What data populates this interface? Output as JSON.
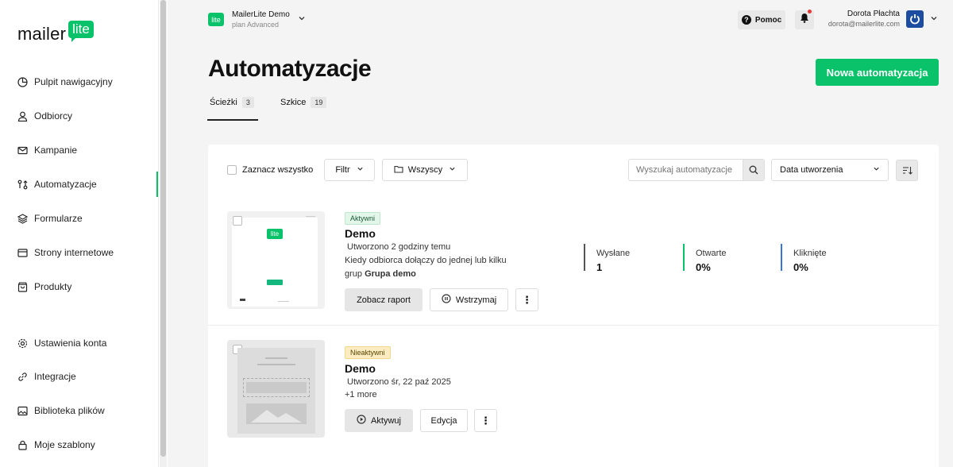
{
  "sidebar": {
    "logo_text": "mailer",
    "logo_badge": "lite",
    "items": [
      {
        "label": "Pulpit nawigacyjny",
        "icon": "dashboard-icon"
      },
      {
        "label": "Odbiorcy",
        "icon": "person-icon"
      },
      {
        "label": "Kampanie",
        "icon": "mail-icon"
      },
      {
        "label": "Automatyzacje",
        "icon": "automation-icon"
      },
      {
        "label": "Formularze",
        "icon": "layers-icon"
      },
      {
        "label": "Strony internetowe",
        "icon": "browser-icon"
      },
      {
        "label": "Produkty",
        "icon": "bag-icon"
      },
      {
        "label": "Ustawienia konta",
        "icon": "gear-icon"
      },
      {
        "label": "Integracje",
        "icon": "link-icon"
      },
      {
        "label": "Biblioteka plików",
        "icon": "image-icon"
      },
      {
        "label": "Moje szablony",
        "icon": "lock-icon"
      }
    ]
  },
  "header": {
    "account_logo": "lite",
    "account_name": "MailerLite Demo",
    "account_plan": "plan Advanced",
    "help_label": "Pomoc",
    "user_name": "Dorota Płachta",
    "user_email": "dorota@mailerlite.com"
  },
  "page": {
    "title": "Automatyzacje",
    "new_button": "Nowa automatyzacja",
    "tabs": [
      {
        "label": "Ścieżki",
        "count": "3"
      },
      {
        "label": "Szkice",
        "count": "19"
      }
    ]
  },
  "toolbar": {
    "select_all": "Zaznacz wszystko",
    "filter": "Filtr",
    "folder": "Wszyscy",
    "search_placeholder": "Wyszukaj automatyzacje",
    "sort": "Data utworzenia"
  },
  "automations": [
    {
      "status": "Aktywni",
      "name": "Demo",
      "created": "Utworzono 2 godziny temu",
      "trigger_line1": "Kiedy odbiorca dołączy do jednej lub kilku",
      "trigger_prefix": "grup",
      "trigger_group": "Grupa demo",
      "stats": [
        {
          "label": "Wysłane",
          "value": "1"
        },
        {
          "label": "Otwarte",
          "value": "0%"
        },
        {
          "label": "Kliknięte",
          "value": "0%"
        }
      ],
      "btn_report": "Zobacz raport",
      "btn_pause": "Wstrzymaj"
    },
    {
      "status": "Nieaktywni",
      "name": "Demo",
      "created": "Utworzono śr, 22 paź 2025",
      "more": "+1 more",
      "btn_activate": "Aktywuj",
      "btn_edit": "Edycja"
    }
  ],
  "colors": {
    "brand": "#09c269",
    "active_badge_bg": "#e3f6ea",
    "inactive_badge_bg": "#fbecc1",
    "stat_sent": "#555555",
    "stat_opened": "#09c269",
    "stat_clicked": "#3b73d8"
  }
}
